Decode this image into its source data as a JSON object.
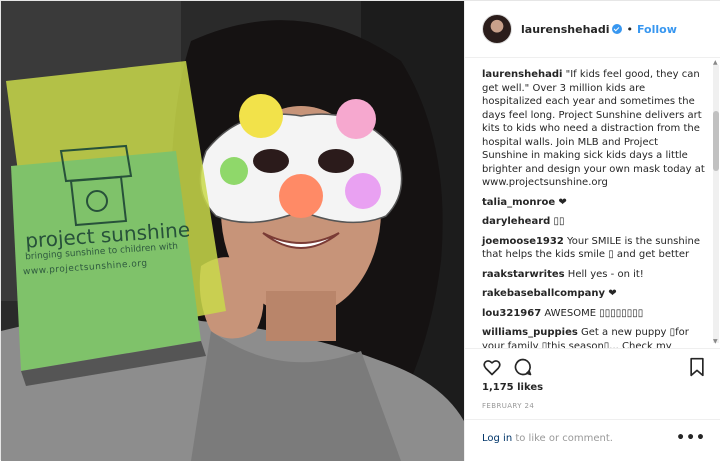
{
  "post": {
    "username": "laurenshehadi",
    "verified_icon": "verified-badge-icon",
    "separator": "•",
    "follow_label": "Follow"
  },
  "photo": {
    "bag_title": "project sunshine",
    "bag_subtitle": "bringing sunshine to children with",
    "bag_url": "www.projectsunshine.org"
  },
  "caption": {
    "username": "laurenshehadi",
    "text": "\"If kids feel good, they can get well.\" Over 3 million kids are hospitalized each year and sometimes the days feel long. Project Sunshine delivers art kits to kids who need a distraction from the hospital walls. Join MLB and Project Sunshine in making sick kids days a little brighter and design your own mask today at www.projectsunshine.org"
  },
  "comments": [
    {
      "username": "talia_monroe",
      "text": "❤"
    },
    {
      "username": "daryleheard",
      "text": "▯▯"
    },
    {
      "username": "joemoose1932",
      "text": "Your SMILE is the sunshine that helps the kids smile ▯ and get better"
    },
    {
      "username": "raakstarwrites",
      "text": "Hell yes - on it!"
    },
    {
      "username": "rakebaseballcompany",
      "text": "❤"
    },
    {
      "username": "lou321967",
      "text": "AWESOME ▯▯▯▯▯▯▯▯"
    },
    {
      "username": "williams_puppies",
      "text": "Get a new puppy ▯for your family ▯this season▯... Check my"
    }
  ],
  "actions": {
    "like_icon": "heart-icon",
    "comment_icon": "comment-bubble-icon",
    "save_icon": "bookmark-icon"
  },
  "likes_text": "1,175 likes",
  "date_text": "FEBRUARY 24",
  "footer": {
    "login_link": "Log in",
    "login_rest": " to like or comment.",
    "more_label": "•••"
  },
  "colors": {
    "link_blue": "#3897f0",
    "text": "#262626",
    "muted": "#999999",
    "bag_green": "#7fc26a"
  }
}
